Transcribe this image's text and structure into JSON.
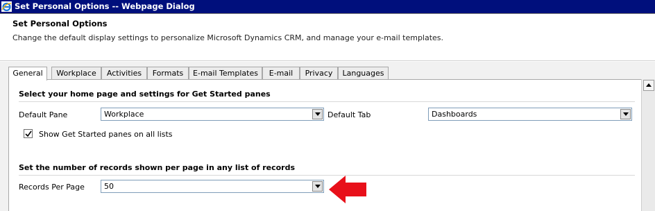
{
  "window": {
    "title": "Set Personal Options -- Webpage Dialog"
  },
  "header": {
    "title": "Set Personal Options",
    "description": "Change the default display settings to personalize Microsoft Dynamics CRM, and manage your e-mail templates."
  },
  "tabs": [
    {
      "label": "General",
      "active": true
    },
    {
      "label": "Workplace",
      "active": false
    },
    {
      "label": "Activities",
      "active": false
    },
    {
      "label": "Formats",
      "active": false
    },
    {
      "label": "E-mail Templates",
      "active": false
    },
    {
      "label": "E-mail",
      "active": false
    },
    {
      "label": "Privacy",
      "active": false
    },
    {
      "label": "Languages",
      "active": false
    }
  ],
  "general": {
    "section1_title": "Select your home page and settings for Get Started panes",
    "default_pane_label": "Default Pane",
    "default_pane_value": "Workplace",
    "default_tab_label": "Default Tab",
    "default_tab_value": "Dashboards",
    "show_get_started_label": "Show Get Started panes on all lists",
    "show_get_started_checked": true,
    "section2_title": "Set the number of records shown per page in any list of records",
    "records_per_page_label": "Records Per Page",
    "records_per_page_value": "50"
  },
  "colors": {
    "titlebar": "#000f7c",
    "annotation_arrow": "#e8101a"
  }
}
